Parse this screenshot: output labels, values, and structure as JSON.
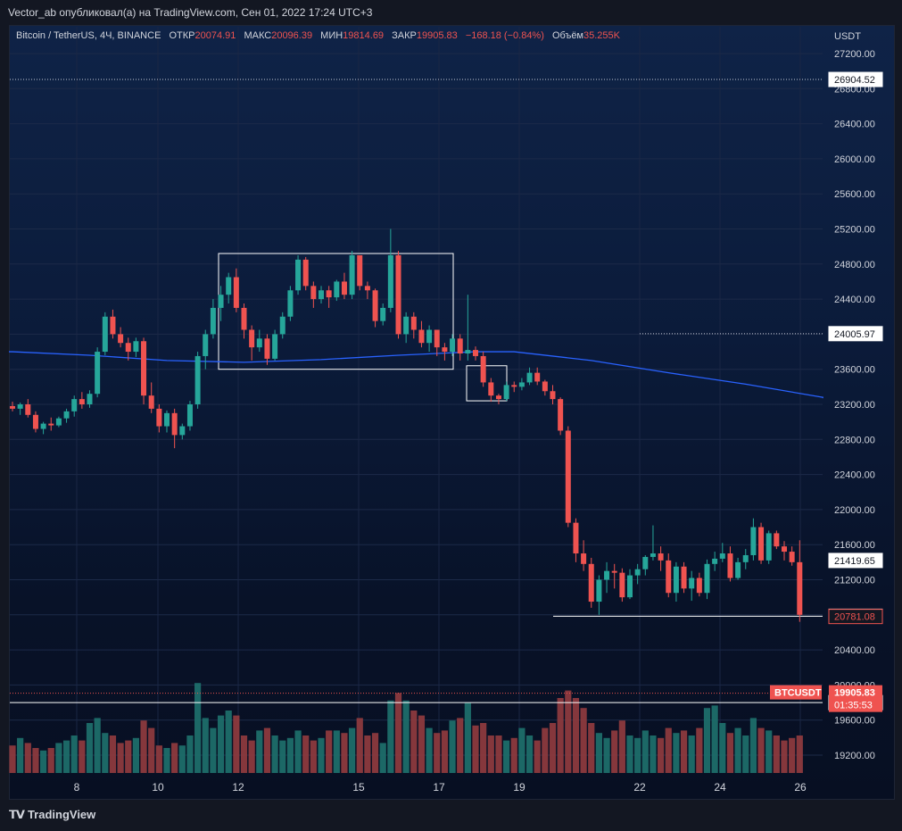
{
  "header": {
    "publisher_text": "Vector_ab опубликовал(а) на TradingView.com, Сен 01, 2022 17:24 UTC+3"
  },
  "legend": {
    "symbol": "Bitcoin / TetherUS, 4Ч, BINANCE",
    "open_label": "ОТКР",
    "open_value": "20074.91",
    "high_label": "МАКС",
    "high_value": "20096.39",
    "low_label": "МИН",
    "low_value": "19814.69",
    "close_label": "ЗАКР",
    "close_value": "19905.83",
    "change": "−168.18 (−0.84%)",
    "volume_label": "Объём",
    "volume_value": "35.255K"
  },
  "price_axis": {
    "currency": "USDT",
    "ticks": [
      "27200.00",
      "26800.00",
      "26400.00",
      "26000.00",
      "25600.00",
      "25200.00",
      "24800.00",
      "24400.00",
      "24000.00",
      "23600.00",
      "23200.00",
      "22800.00",
      "22400.00",
      "22000.00",
      "21600.00",
      "21200.00",
      "20800.00",
      "20400.00",
      "20000.00",
      "19600.00",
      "19200.00"
    ]
  },
  "time_axis": {
    "labels": [
      "8",
      "10",
      "12",
      "15",
      "17",
      "19",
      "22",
      "24",
      "26"
    ]
  },
  "price_labels": {
    "level_top": "26904.52",
    "level_mid": "24005.97",
    "level_21419": "21419.65",
    "level_20783": "20783.57",
    "level_20781": "20781.08",
    "symbol_tag": "BTCUSDT",
    "last_price": "19905.83",
    "countdown": "01:35:53",
    "level_19798": "19798.68"
  },
  "colors": {
    "up": "#26a69a",
    "down": "#ef5350",
    "ma_line": "#2962ff",
    "text": "#d1d4dc"
  },
  "footer": {
    "brand": "TradingView"
  },
  "chart_data": {
    "type": "candlestick",
    "title": "Bitcoin / TetherUS, 4Ч, BINANCE",
    "ylim": [
      19000,
      27400
    ],
    "x_ticks": [
      "8",
      "10",
      "12",
      "15",
      "17",
      "19",
      "22",
      "24",
      "26"
    ],
    "candles_ohlc": [
      [
        23180,
        23230,
        23120,
        23150
      ],
      [
        23150,
        23220,
        23080,
        23200
      ],
      [
        23200,
        23260,
        23050,
        23080
      ],
      [
        23080,
        23120,
        22880,
        22920
      ],
      [
        22920,
        23000,
        22860,
        22980
      ],
      [
        22980,
        23050,
        22900,
        22960
      ],
      [
        22960,
        23060,
        22940,
        23040
      ],
      [
        23040,
        23150,
        22990,
        23120
      ],
      [
        23120,
        23300,
        23060,
        23260
      ],
      [
        23260,
        23340,
        23150,
        23200
      ],
      [
        23200,
        23360,
        23160,
        23320
      ],
      [
        23320,
        23850,
        23280,
        23800
      ],
      [
        23800,
        24250,
        23760,
        24200
      ],
      [
        24200,
        24280,
        23950,
        24000
      ],
      [
        24000,
        24080,
        23850,
        23900
      ],
      [
        23900,
        23960,
        23700,
        23800
      ],
      [
        23800,
        23960,
        23740,
        23920
      ],
      [
        23920,
        23960,
        23200,
        23300
      ],
      [
        23300,
        23450,
        23100,
        23150
      ],
      [
        23150,
        23200,
        22880,
        22950
      ],
      [
        22950,
        23130,
        22880,
        23100
      ],
      [
        23100,
        23150,
        22700,
        22850
      ],
      [
        22850,
        22980,
        22800,
        22950
      ],
      [
        22950,
        23240,
        22900,
        23200
      ],
      [
        23200,
        23800,
        23150,
        23750
      ],
      [
        23750,
        24050,
        23600,
        24000
      ],
      [
        24000,
        24400,
        23950,
        24300
      ],
      [
        24300,
        24550,
        24150,
        24450
      ],
      [
        24450,
        24700,
        24350,
        24650
      ],
      [
        24650,
        24750,
        24250,
        24300
      ],
      [
        24300,
        24350,
        23950,
        24050
      ],
      [
        24050,
        24100,
        23700,
        23850
      ],
      [
        23850,
        24050,
        23800,
        23950
      ],
      [
        23950,
        24000,
        23650,
        23720
      ],
      [
        23720,
        24050,
        23700,
        24000
      ],
      [
        24000,
        24250,
        23950,
        24200
      ],
      [
        24200,
        24550,
        24150,
        24500
      ],
      [
        24500,
        24900,
        24450,
        24850
      ],
      [
        24850,
        24880,
        24500,
        24550
      ],
      [
        24550,
        24600,
        24300,
        24400
      ],
      [
        24400,
        24550,
        24350,
        24500
      ],
      [
        24500,
        24550,
        24300,
        24420
      ],
      [
        24420,
        24620,
        24380,
        24600
      ],
      [
        24600,
        24700,
        24400,
        24450
      ],
      [
        24450,
        24950,
        24400,
        24900
      ],
      [
        24900,
        24900,
        24500,
        24550
      ],
      [
        24550,
        24600,
        24400,
        24500
      ],
      [
        24500,
        24520,
        24080,
        24150
      ],
      [
        24150,
        24350,
        24100,
        24300
      ],
      [
        24300,
        25200,
        24250,
        24900
      ],
      [
        24900,
        24950,
        23950,
        24000
      ],
      [
        24000,
        24250,
        23900,
        24200
      ],
      [
        24200,
        24250,
        23950,
        24050
      ],
      [
        24050,
        24150,
        23850,
        23900
      ],
      [
        23900,
        24100,
        23800,
        24050
      ],
      [
        24050,
        24050,
        23750,
        23850
      ],
      [
        23850,
        23900,
        23700,
        23800
      ],
      [
        23800,
        24000,
        23750,
        23950
      ],
      [
        23950,
        24000,
        23700,
        23780
      ],
      [
        23780,
        24450,
        23700,
        23820
      ],
      [
        23820,
        23860,
        23700,
        23750
      ],
      [
        23750,
        23800,
        23400,
        23450
      ],
      [
        23450,
        23500,
        23230,
        23300
      ],
      [
        23300,
        23320,
        23200,
        23260
      ],
      [
        23260,
        23460,
        23240,
        23420
      ],
      [
        23420,
        23460,
        23340,
        23400
      ],
      [
        23400,
        23500,
        23360,
        23450
      ],
      [
        23450,
        23620,
        23420,
        23560
      ],
      [
        23560,
        23620,
        23420,
        23460
      ],
      [
        23460,
        23480,
        23300,
        23350
      ],
      [
        23350,
        23420,
        23200,
        23260
      ],
      [
        23260,
        23280,
        22850,
        22900
      ],
      [
        22900,
        22950,
        21800,
        21850
      ],
      [
        21850,
        21900,
        21400,
        21500
      ],
      [
        21500,
        21650,
        21300,
        21380
      ],
      [
        21380,
        21450,
        20880,
        20950
      ],
      [
        20950,
        21250,
        20800,
        21200
      ],
      [
        21200,
        21400,
        21050,
        21300
      ],
      [
        21300,
        21380,
        21100,
        21280
      ],
      [
        21280,
        21330,
        20950,
        21000
      ],
      [
        21000,
        21320,
        20980,
        21250
      ],
      [
        21250,
        21380,
        21150,
        21320
      ],
      [
        21320,
        21480,
        21250,
        21460
      ],
      [
        21460,
        21820,
        21420,
        21500
      ],
      [
        21500,
        21580,
        21300,
        21420
      ],
      [
        21420,
        21500,
        21000,
        21050
      ],
      [
        21050,
        21400,
        20950,
        21350
      ],
      [
        21350,
        21400,
        21050,
        21100
      ],
      [
        21100,
        21300,
        20960,
        21220
      ],
      [
        21220,
        21280,
        21010,
        21050
      ],
      [
        21050,
        21430,
        20980,
        21380
      ],
      [
        21380,
        21520,
        21300,
        21440
      ],
      [
        21440,
        21620,
        21400,
        21500
      ],
      [
        21500,
        21580,
        21180,
        21220
      ],
      [
        21220,
        21450,
        21200,
        21400
      ],
      [
        21400,
        21550,
        21320,
        21480
      ],
      [
        21480,
        21900,
        21420,
        21800
      ],
      [
        21800,
        21850,
        21380,
        21420
      ],
      [
        21420,
        21760,
        21380,
        21730
      ],
      [
        21730,
        21760,
        21550,
        21580
      ],
      [
        21580,
        21640,
        21420,
        21520
      ],
      [
        21520,
        21580,
        21360,
        21400
      ],
      [
        21400,
        21650,
        20720,
        20800
      ]
    ],
    "volume_levels_0_1": [
      0.22,
      0.28,
      0.24,
      0.2,
      0.18,
      0.2,
      0.24,
      0.26,
      0.3,
      0.26,
      0.4,
      0.44,
      0.32,
      0.3,
      0.24,
      0.26,
      0.28,
      0.42,
      0.36,
      0.22,
      0.2,
      0.24,
      0.22,
      0.3,
      0.72,
      0.44,
      0.36,
      0.46,
      0.5,
      0.46,
      0.3,
      0.26,
      0.34,
      0.36,
      0.3,
      0.26,
      0.28,
      0.34,
      0.3,
      0.26,
      0.28,
      0.34,
      0.34,
      0.32,
      0.36,
      0.44,
      0.3,
      0.32,
      0.24,
      0.58,
      0.64,
      0.58,
      0.5,
      0.46,
      0.36,
      0.32,
      0.34,
      0.42,
      0.44,
      0.56,
      0.38,
      0.4,
      0.3,
      0.3,
      0.26,
      0.28,
      0.36,
      0.3,
      0.26,
      0.36,
      0.4,
      0.6,
      0.66,
      0.6,
      0.52,
      0.4,
      0.32,
      0.28,
      0.34,
      0.42,
      0.3,
      0.28,
      0.34,
      0.3,
      0.28,
      0.36,
      0.32,
      0.34,
      0.3,
      0.36,
      0.52,
      0.54,
      0.4,
      0.32,
      0.36,
      0.3,
      0.44,
      0.36,
      0.34,
      0.3,
      0.26,
      0.28,
      0.3,
      0.42,
      0.62
    ],
    "ma_points": [
      [
        0,
        23800
      ],
      [
        10,
        23760
      ],
      [
        20,
        23700
      ],
      [
        30,
        23680
      ],
      [
        40,
        23710
      ],
      [
        50,
        23760
      ],
      [
        60,
        23800
      ],
      [
        65,
        23800
      ],
      [
        75,
        23700
      ],
      [
        85,
        23560
      ],
      [
        95,
        23430
      ],
      [
        105,
        23280
      ]
    ]
  }
}
